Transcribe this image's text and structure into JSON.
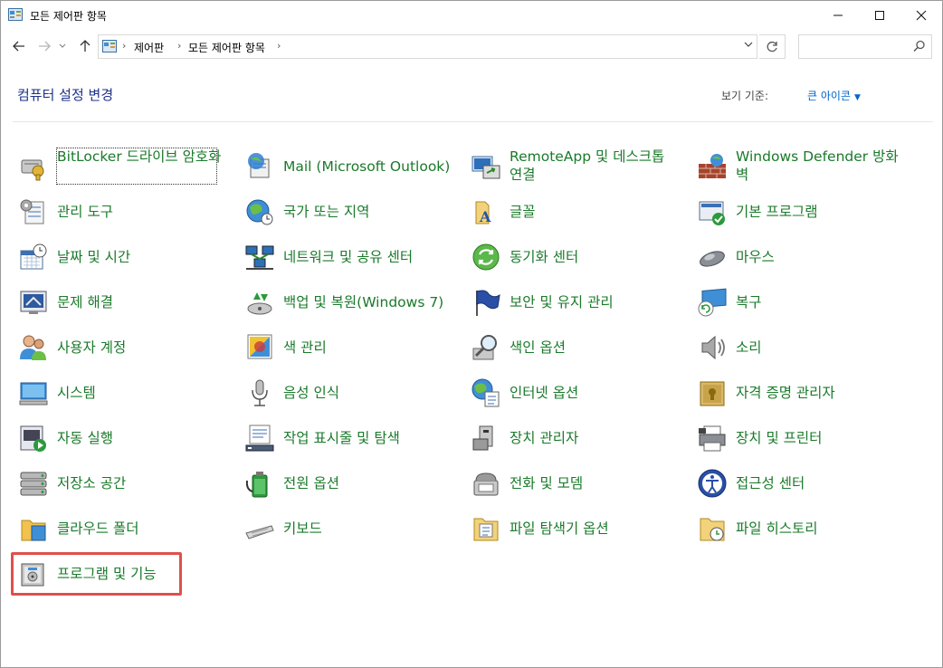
{
  "window": {
    "title": "모든 제어판 항목",
    "controls": {
      "minimize": "—",
      "maximize": "☐",
      "close": "✕"
    }
  },
  "nav": {
    "back_icon": "arrow-left-icon",
    "forward_icon": "arrow-right-icon",
    "up_icon": "arrow-up-icon",
    "breadcrumbs": [
      "제어판",
      "모든 제어판 항목"
    ],
    "search_placeholder": ""
  },
  "header": {
    "title": "컴퓨터 설정 변경",
    "view_label": "보기 기준:",
    "view_value": "큰 아이콘"
  },
  "items": [
    {
      "label": "BitLocker 드라이브 암호화",
      "icon": "bitlocker-icon"
    },
    {
      "label": "Mail (Microsoft Outlook)",
      "icon": "mail-icon"
    },
    {
      "label": "RemoteApp 및 데스크톱 연결",
      "icon": "remoteapp-icon"
    },
    {
      "label": "Windows Defender 방화벽",
      "icon": "firewall-icon"
    },
    {
      "label": "관리 도구",
      "icon": "admin-tools-icon"
    },
    {
      "label": "국가 또는 지역",
      "icon": "region-icon"
    },
    {
      "label": "글꼴",
      "icon": "fonts-icon"
    },
    {
      "label": "기본 프로그램",
      "icon": "default-programs-icon"
    },
    {
      "label": "날짜 및 시간",
      "icon": "date-time-icon"
    },
    {
      "label": "네트워크 및 공유 센터",
      "icon": "network-icon"
    },
    {
      "label": "동기화 센터",
      "icon": "sync-icon"
    },
    {
      "label": "마우스",
      "icon": "mouse-icon"
    },
    {
      "label": "문제 해결",
      "icon": "troubleshoot-icon"
    },
    {
      "label": "백업 및 복원(Windows 7)",
      "icon": "backup-icon"
    },
    {
      "label": "보안 및 유지 관리",
      "icon": "security-flag-icon"
    },
    {
      "label": "복구",
      "icon": "recovery-icon"
    },
    {
      "label": "사용자 계정",
      "icon": "user-accounts-icon"
    },
    {
      "label": "색 관리",
      "icon": "color-management-icon"
    },
    {
      "label": "색인 옵션",
      "icon": "indexing-icon"
    },
    {
      "label": "소리",
      "icon": "sound-icon"
    },
    {
      "label": "시스템",
      "icon": "system-icon"
    },
    {
      "label": "음성 인식",
      "icon": "microphone-icon"
    },
    {
      "label": "인터넷 옵션",
      "icon": "internet-options-icon"
    },
    {
      "label": "자격 증명 관리자",
      "icon": "credential-icon"
    },
    {
      "label": "자동 실행",
      "icon": "autoplay-icon"
    },
    {
      "label": "작업 표시줄 및 탐색",
      "icon": "taskbar-icon"
    },
    {
      "label": "장치 관리자",
      "icon": "device-manager-icon"
    },
    {
      "label": "장치 및 프린터",
      "icon": "printer-icon"
    },
    {
      "label": "저장소 공간",
      "icon": "storage-icon"
    },
    {
      "label": "전원 옵션",
      "icon": "power-icon"
    },
    {
      "label": "전화 및 모뎀",
      "icon": "phone-icon"
    },
    {
      "label": "접근성 센터",
      "icon": "accessibility-icon"
    },
    {
      "label": "클라우드 폴더",
      "icon": "cloud-folder-icon"
    },
    {
      "label": "키보드",
      "icon": "keyboard-icon"
    },
    {
      "label": "파일 탐색기 옵션",
      "icon": "folder-options-icon"
    },
    {
      "label": "파일 히스토리",
      "icon": "file-history-icon"
    },
    {
      "label": "프로그램 및 기능",
      "icon": "programs-features-icon"
    }
  ],
  "colors": {
    "link_green": "#1a7a2a",
    "title_blue": "#1e3287",
    "highlight_red": "#e0504a"
  }
}
